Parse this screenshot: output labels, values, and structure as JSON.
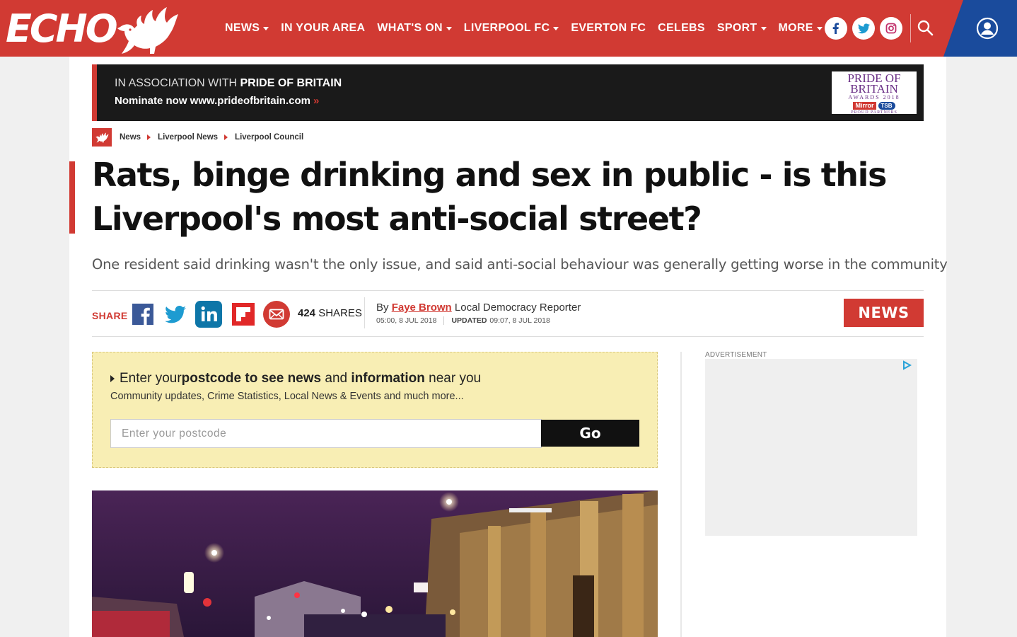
{
  "header": {
    "logo_text": "ECHO",
    "nav": [
      {
        "label": "NEWS",
        "dropdown": true
      },
      {
        "label": "IN YOUR AREA",
        "dropdown": false
      },
      {
        "label": "WHAT'S ON",
        "dropdown": true
      },
      {
        "label": "LIVERPOOL FC",
        "dropdown": true
      },
      {
        "label": "EVERTON FC",
        "dropdown": false
      },
      {
        "label": "CELEBS",
        "dropdown": false
      },
      {
        "label": "SPORT",
        "dropdown": true
      },
      {
        "label": "MORE",
        "dropdown": true
      }
    ],
    "social_icons": [
      "facebook-icon",
      "twitter-icon",
      "instagram-icon"
    ],
    "colors": {
      "brand_red": "#d13a33",
      "account_blue": "#1a4b9c"
    }
  },
  "banner": {
    "prefix": "IN ASSOCIATION WITH ",
    "strong": "PRIDE OF BRITAIN",
    "line2": "Nominate now www.prideofbritain.com",
    "chevron": "»",
    "logo": {
      "line1": "PRIDE OF",
      "line2": "BRITAIN",
      "line3": "AWARDS 2018",
      "mirror": "Mirror",
      "tsb": "TSB",
      "line4": "PROUD PARTNERS"
    }
  },
  "breadcrumb": [
    "News",
    "Liverpool News",
    "Liverpool Council"
  ],
  "article": {
    "headline": "Rats, binge drinking and sex in public - is this Liverpool's most anti-social street?",
    "standfirst": "One resident said drinking wasn't the only issue, and said anti-social behaviour was generally getting worse in the community",
    "share_label": "SHARE",
    "share_count": "424",
    "share_count_label": " SHARES",
    "byline_prefix": "By ",
    "author": "Faye Brown",
    "author_role": " Local Democracy Reporter",
    "published": "05:00, 8 JUL 2018",
    "updated_label": "UPDATED",
    "updated": "09:07, 8 JUL 2018",
    "section_badge": "NEWS"
  },
  "postcode": {
    "title_parts": [
      "Enter your ",
      "postcode to see news",
      " and ",
      "information",
      " near you"
    ],
    "subtitle": "Community updates, Crime Statistics, Local News & Events and much more...",
    "placeholder": "Enter your postcode",
    "value": "",
    "button": "Go"
  },
  "sidebar": {
    "ad_label": "ADVERTISEMENT"
  }
}
